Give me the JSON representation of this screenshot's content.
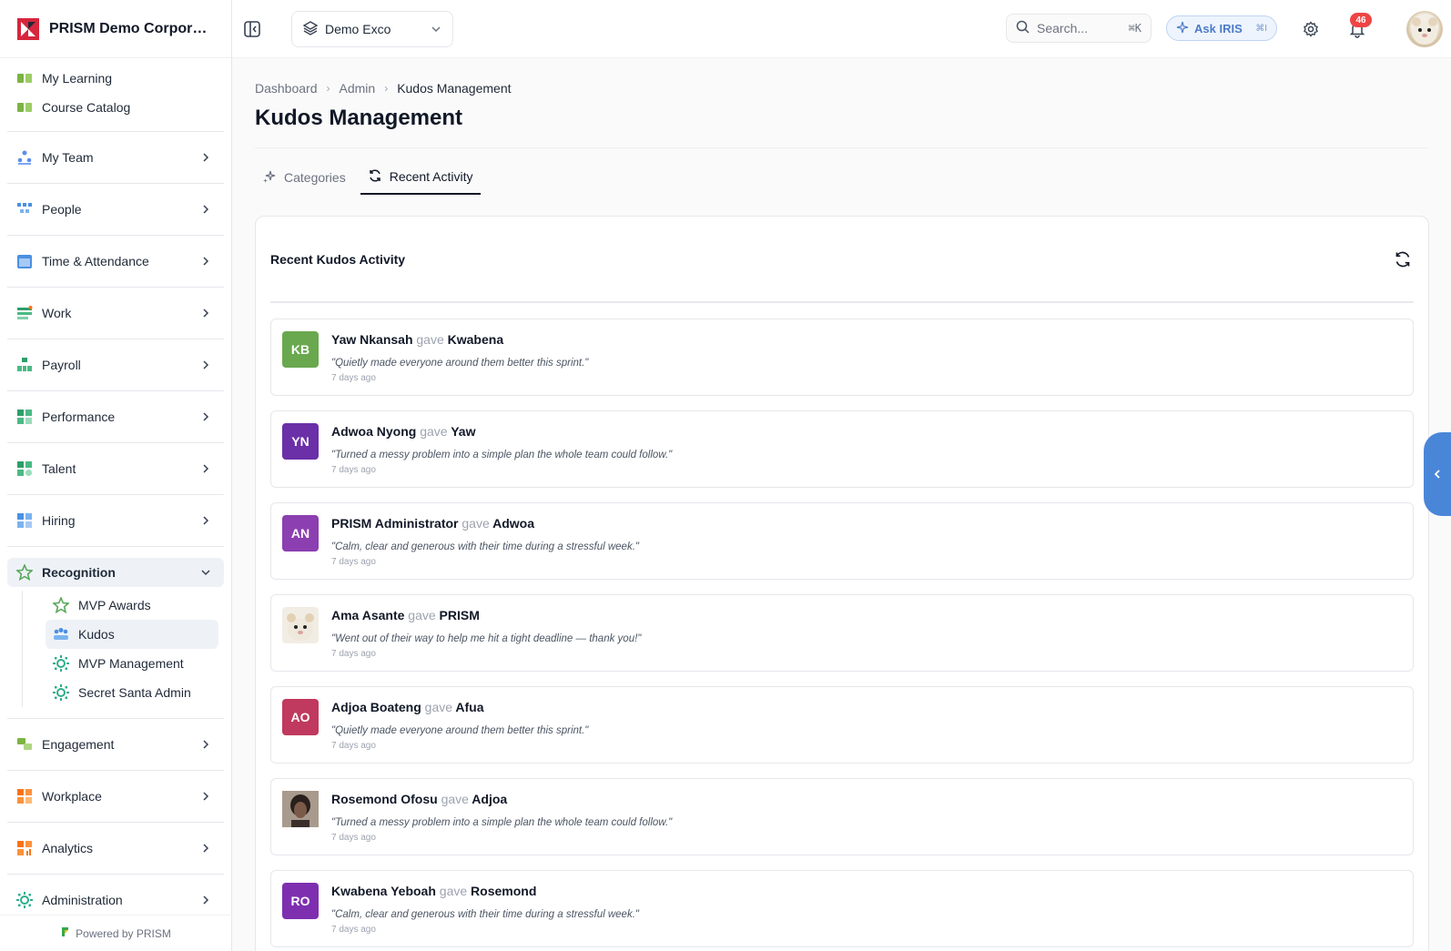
{
  "brand": {
    "name": "PRISM Demo Corporation"
  },
  "sidebar": {
    "top_items": [
      {
        "label": "My Learning",
        "icon": "learning-icon"
      },
      {
        "label": "Course Catalog",
        "icon": "catalog-icon"
      }
    ],
    "groups": [
      {
        "label": "My Team"
      },
      {
        "label": "People"
      },
      {
        "label": "Time & Attendance"
      },
      {
        "label": "Work"
      },
      {
        "label": "Payroll"
      },
      {
        "label": "Performance"
      },
      {
        "label": "Talent"
      },
      {
        "label": "Hiring"
      }
    ],
    "recognition": {
      "label": "Recognition",
      "sub": [
        {
          "label": "MVP Awards"
        },
        {
          "label": "Kudos"
        },
        {
          "label": "MVP Management"
        },
        {
          "label": "Secret Santa Admin"
        }
      ]
    },
    "bottom_groups": [
      {
        "label": "Engagement"
      },
      {
        "label": "Workplace"
      },
      {
        "label": "Analytics"
      },
      {
        "label": "Administration"
      }
    ],
    "powered": "Powered by PRISM"
  },
  "topbar": {
    "workspace": "Demo Exco",
    "search_placeholder": "Search...",
    "search_kbd": "⌘K",
    "ask_label": "Ask IRIS",
    "ask_kbd": "⌘I",
    "notifications": "46"
  },
  "breadcrumb": [
    "Dashboard",
    "Admin",
    "Kudos Management"
  ],
  "page_title": "Kudos Management",
  "tabs": [
    {
      "label": "Categories"
    },
    {
      "label": "Recent Activity"
    }
  ],
  "card_title": "Recent Kudos Activity",
  "activities": [
    {
      "initials": "KB",
      "color": "#6aa84f",
      "from": "Yaw Nkansah",
      "gave": "gave",
      "to": "Kwabena",
      "message": "\"Quietly made everyone around them better this sprint.\"",
      "time": "7 days ago"
    },
    {
      "initials": "YN",
      "color": "#6b2fa8",
      "from": "Adwoa Nyong",
      "gave": "gave",
      "to": "Yaw",
      "message": "\"Turned a messy problem into a simple plan the whole team could follow.\"",
      "time": "7 days ago"
    },
    {
      "initials": "AN",
      "color": "#8b3fb0",
      "from": "PRISM Administrator",
      "gave": "gave",
      "to": "Adwoa",
      "message": "\"Calm, clear and generous with their time during a stressful week.\"",
      "time": "7 days ago"
    },
    {
      "initials": "",
      "color": "#f2ede4",
      "from": "Ama Asante",
      "gave": "gave",
      "to": "PRISM",
      "message": "\"Went out of their way to help me hit a tight deadline — thank you!\"",
      "time": "7 days ago"
    },
    {
      "initials": "AO",
      "color": "#c0395e",
      "from": "Adjoa Boateng",
      "gave": "gave",
      "to": "Afua",
      "message": "\"Quietly made everyone around them better this sprint.\"",
      "time": "7 days ago"
    },
    {
      "initials": "",
      "color": "#5a4a42",
      "from": "Rosemond Ofosu",
      "gave": "gave",
      "to": "Adjoa",
      "message": "\"Turned a messy problem into a simple plan the whole team could follow.\"",
      "time": "7 days ago"
    },
    {
      "initials": "RO",
      "color": "#7d2fb0",
      "from": "Kwabena Yeboah",
      "gave": "gave",
      "to": "Rosemond",
      "message": "\"Calm, clear and generous with their time during a stressful week.\"",
      "time": "7 days ago"
    }
  ]
}
